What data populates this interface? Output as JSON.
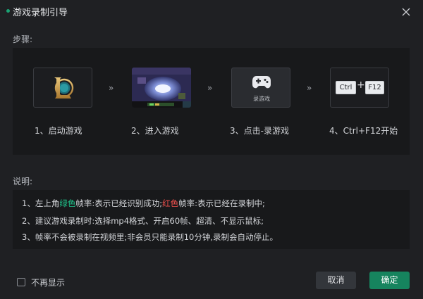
{
  "window": {
    "title": "游戏录制引导",
    "accent_color": "#1aa374"
  },
  "steps": {
    "label": "步骤:",
    "arrow": "»",
    "items": [
      {
        "caption": "1、启动游戏",
        "icon": "league-of-legends-logo"
      },
      {
        "caption": "2、进入游戏",
        "icon": "game-screenshot"
      },
      {
        "caption": "3、点击-录游戏",
        "icon": "gamepad-icon",
        "button_label": "录游戏"
      },
      {
        "caption": "4、Ctrl+F12开始",
        "icon": "keyboard-shortcut",
        "keys": [
          "Ctrl",
          "+",
          "F12"
        ]
      }
    ]
  },
  "description": {
    "label": "说明:",
    "line1": {
      "prefix": "1、左上角",
      "green_word": "绿色",
      "middle": "帧率:表示已经识别成功;",
      "red_word": "红色",
      "suffix": "帧率:表示已经在录制中;"
    },
    "line2": "2、建议游戏录制时:选择mp4格式、开启60帧、超清、不显示鼠标;",
    "line3": "3、帧率不会被录制在视频里;非会员只能录制10分钟,录制会自动停止。",
    "green_color": "#1fc28a",
    "red_color": "#f0504c"
  },
  "footer": {
    "no_show_label": "不再显示",
    "no_show_checked": false,
    "cancel_label": "取消",
    "ok_label": "确定",
    "ok_color": "#16845e"
  }
}
